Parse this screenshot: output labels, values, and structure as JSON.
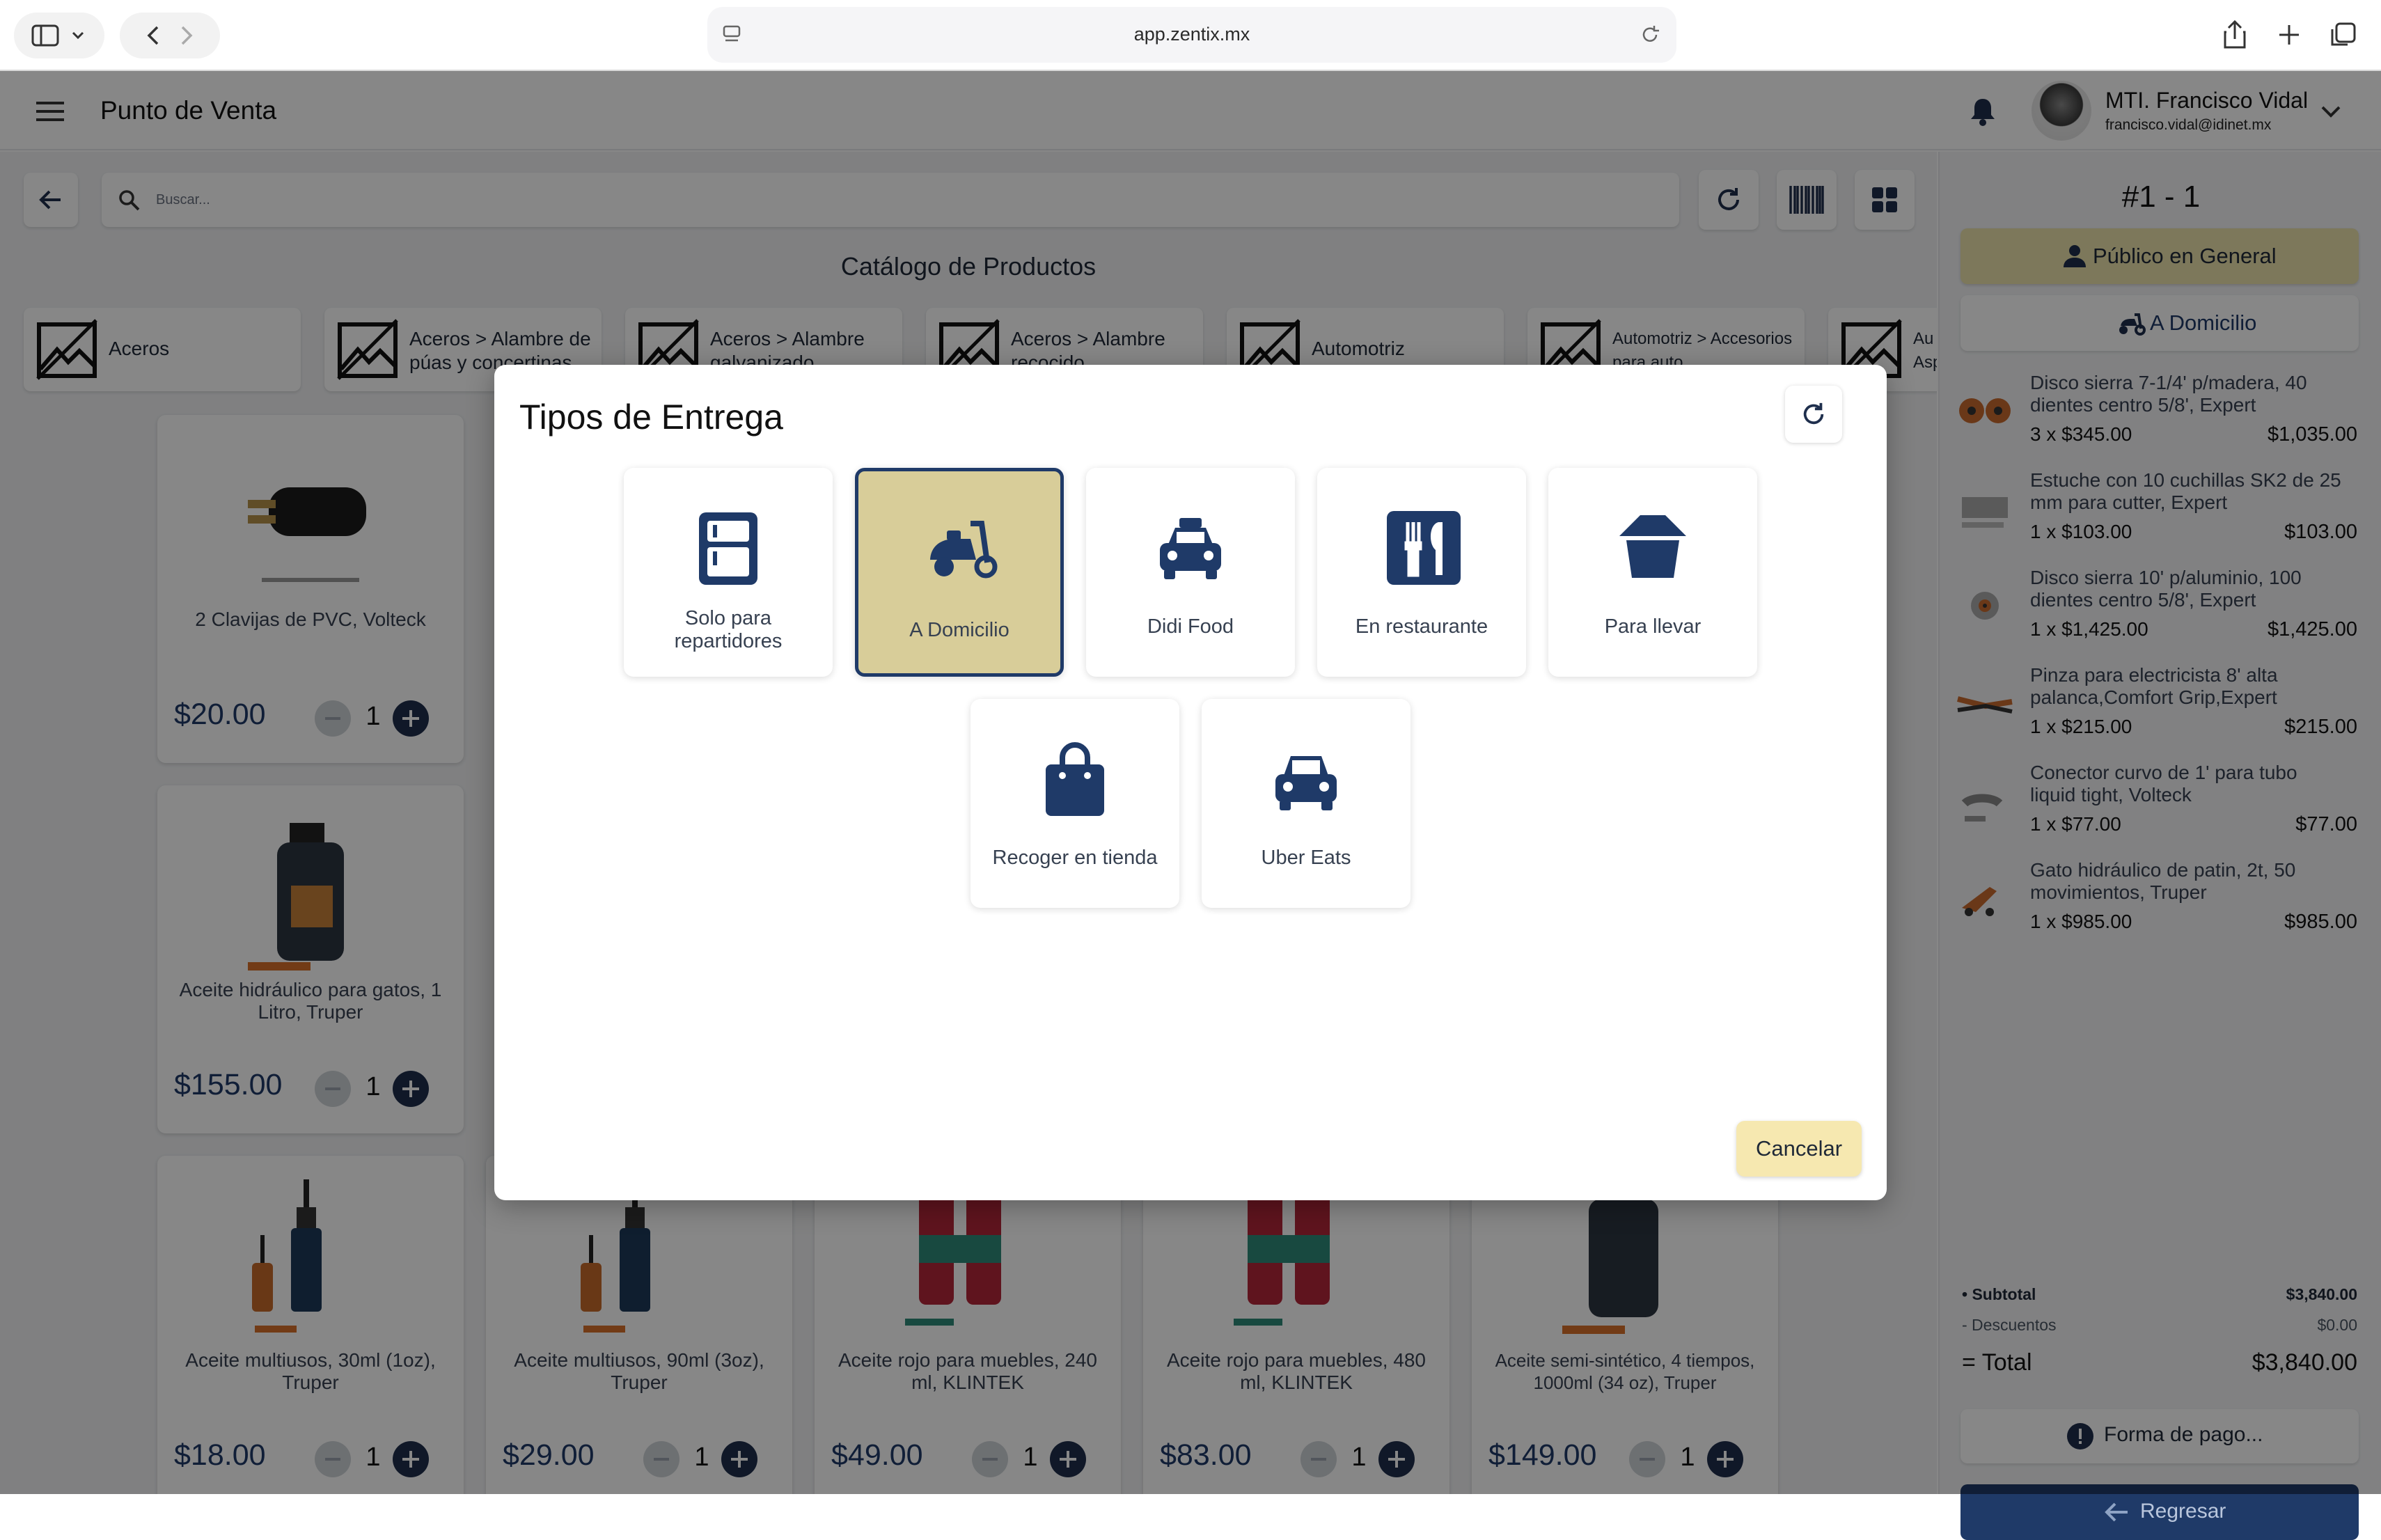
{
  "browser": {
    "url": "app.zentix.mx"
  },
  "app": {
    "title": "Punto de Venta",
    "user": {
      "name": "MTI. Francisco Vidal",
      "email": "francisco.vidal@idinet.mx"
    }
  },
  "toolbar": {
    "search_placeholder": "Buscar..."
  },
  "catalog": {
    "title": "Catálogo de Productos",
    "categories": [
      "Aceros",
      "Aceros > Alambre de púas y concertinas",
      "Aceros > Alambre galvanizado",
      "Aceros > Alambre recocido",
      "Automotriz",
      "Automotriz > Accesorios para auto",
      "Au Asp"
    ],
    "products": [
      {
        "name": "2 Clavijas de PVC, Volteck",
        "price": "$20.00",
        "qty": "1"
      },
      {
        "name": "Aceite hidráulico para gatos, 1 Litro, Truper",
        "price": "$155.00",
        "qty": "1"
      },
      {
        "name": "Aceite multiusos, 30ml (1oz), Truper",
        "price": "$18.00",
        "qty": "1"
      },
      {
        "name": "Aceite multiusos, 90ml (3oz), Truper",
        "price": "$29.00",
        "qty": "1"
      },
      {
        "name": "Aceite rojo para muebles, 240 ml, KLINTEK",
        "price": "$49.00",
        "qty": "1"
      },
      {
        "name": "Aceite rojo para muebles, 480 ml, KLINTEK",
        "price": "$83.00",
        "qty": "1"
      },
      {
        "name": "Aceite semi-sintético, 4 tiempos, 1000ml (34 oz), Truper",
        "price": "$149.00",
        "qty": "1"
      }
    ]
  },
  "order": {
    "ticket": "#1 - 1",
    "customer_label": "Público en General",
    "delivery_label": "A Domicilio",
    "items": [
      {
        "name": "Disco sierra 7-1/4' p/madera, 40 dientes centro 5/8', Expert",
        "qty": "3",
        "unit": "$345.00",
        "total": "$1,035.00"
      },
      {
        "name": "Estuche con 10 cuchillas SK2 de 25 mm para cutter, Expert",
        "qty": "1",
        "unit": "$103.00",
        "total": "$103.00"
      },
      {
        "name": "Disco sierra 10' p/aluminio, 100 dientes centro 5/8', Expert",
        "qty": "1",
        "unit": "$1,425.00",
        "total": "$1,425.00"
      },
      {
        "name": "Pinza para electricista 8' alta palanca,Comfort Grip,Expert",
        "qty": "1",
        "unit": "$215.00",
        "total": "$215.00"
      },
      {
        "name": "Conector curvo de 1' para tubo liquid tight, Volteck",
        "qty": "1",
        "unit": "$77.00",
        "total": "$77.00"
      },
      {
        "name": "Gato hidráulico de patin, 2t, 50 movimientos, Truper",
        "qty": "1",
        "unit": "$985.00",
        "total": "$985.00"
      }
    ],
    "subtotal_label": "• Subtotal",
    "subtotal": "$3,840.00",
    "discount_label": "- Descuentos",
    "discount": "$0.00",
    "total_label": "= Total",
    "total": "$3,840.00",
    "payment_label": "Forma de pago...",
    "back_label": "Regresar"
  },
  "modal": {
    "title": "Tipos de Entrega",
    "options": [
      {
        "label": "Solo para repartidores",
        "icon": "delivery-box-icon",
        "selected": false
      },
      {
        "label": "A Domicilio",
        "icon": "scooter-icon",
        "selected": true
      },
      {
        "label": "Didi Food",
        "icon": "taxi-icon",
        "selected": false
      },
      {
        "label": "En restaurante",
        "icon": "utensils-icon",
        "selected": false
      },
      {
        "label": "Para llevar",
        "icon": "takeaway-box-icon",
        "selected": false
      },
      {
        "label": "Recoger en tienda",
        "icon": "shopping-bag-icon",
        "selected": false
      },
      {
        "label": "Uber Eats",
        "icon": "car-icon",
        "selected": false
      }
    ],
    "cancel_label": "Cancelar"
  },
  "colors": {
    "primary": "#1f3a68",
    "accent": "#d8cd99",
    "cancel": "#f6e8b0"
  }
}
